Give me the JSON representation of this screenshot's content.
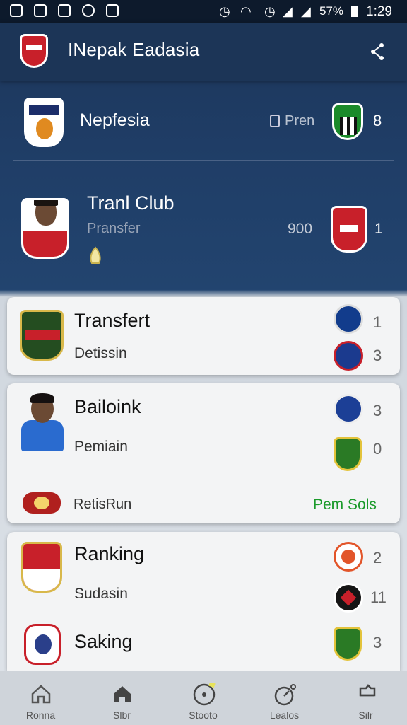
{
  "status_bar": {
    "battery": "57%",
    "time": "1:29"
  },
  "header": {
    "title": "INepak Eadasia"
  },
  "hero": {
    "row1": {
      "name": "Nepfesia",
      "tag": "Pren",
      "score": "8"
    },
    "row2": {
      "title": "Tranl Club",
      "subtitle": "Pransfer",
      "value": "900",
      "score": "1"
    }
  },
  "cards": [
    {
      "title": "Transfert",
      "subtitle": "Detissin",
      "scores": [
        "1",
        "3"
      ]
    },
    {
      "title": "Bailoink",
      "subtitle": "Pemiain",
      "scores": [
        "3",
        "0"
      ],
      "footer_label": "RetisRun",
      "footer_action": "Pem Sols"
    },
    {
      "title": "Ranking",
      "subtitle": "Sudasin",
      "scores": [
        "2",
        "11"
      ],
      "title2": "Saking",
      "score3": "3"
    }
  ],
  "nav": [
    {
      "label": "Ronna",
      "icon": "home-outline-icon"
    },
    {
      "label": "Slbr",
      "icon": "home-filled-icon"
    },
    {
      "label": "Stooto",
      "icon": "ball-icon"
    },
    {
      "label": "Lealos",
      "icon": "gauge-icon"
    },
    {
      "label": "Silr",
      "icon": "shirt-icon"
    }
  ],
  "colors": {
    "header": "#1c3557",
    "accent_green": "#1a9a2a",
    "card": "#f3f4f5"
  }
}
